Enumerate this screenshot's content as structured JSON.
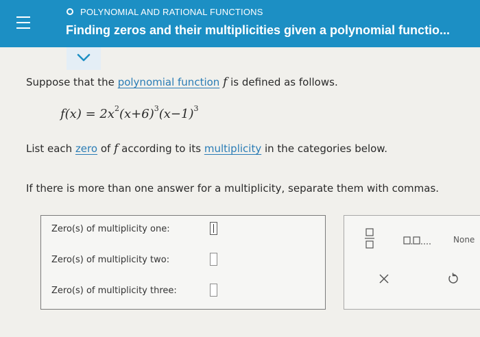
{
  "header": {
    "topic": "POLYNOMIAL AND RATIONAL FUNCTIONS",
    "title": "Finding zeros and their multiplicities given a polynomial functio..."
  },
  "prompt": {
    "line1_start": "Suppose that the ",
    "line1_link": "polynomial function",
    "line1_var": "f",
    "line1_end": " is defined as follows.",
    "formula": {
      "lhs": "f(x) = 2x",
      "exp1": "2",
      "part2": "(x+6)",
      "exp2": "3",
      "part3": "(x−1)",
      "exp3": "3"
    },
    "line2_start": "List each ",
    "line2_link1": "zero",
    "line2_mid": " of ",
    "line2_var": "f",
    "line2_mid2": " according to its ",
    "line2_link2": "multiplicity",
    "line2_end": " in the categories below.",
    "line3": "If there is more than one answer for a multiplicity, separate them with commas."
  },
  "answers": {
    "rows": [
      {
        "label": "Zero(s) of multiplicity one:",
        "value": ""
      },
      {
        "label": "Zero(s) of multiplicity two:",
        "value": ""
      },
      {
        "label": "Zero(s) of multiplicity three:",
        "value": ""
      }
    ]
  },
  "tools": {
    "fraction": "fraction-icon",
    "list": "list-icon",
    "none_label": "None",
    "clear": "clear-icon",
    "undo": "undo-icon"
  },
  "colors": {
    "header_bg": "#1c8fc4",
    "link": "#2a7cb5",
    "background": "#f1f0ec"
  }
}
